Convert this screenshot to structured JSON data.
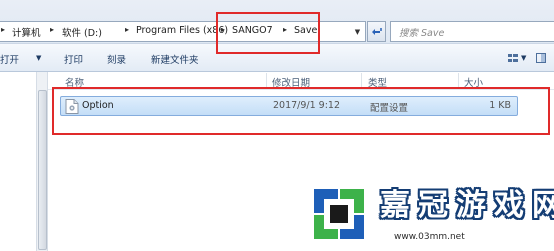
{
  "address_bar": {
    "crumbs": [
      "计算机",
      "软件 (D:)",
      "Program Files (x86)",
      "SANGO7",
      "Save"
    ],
    "separator": "▸",
    "dropdown_icon": "chevron-down-icon",
    "refresh_icon": "refresh-icon"
  },
  "search": {
    "placeholder": "搜索 Save",
    "icon": "search-icon"
  },
  "toolbar": {
    "open_label": "打开",
    "print_label": "打印",
    "burn_label": "刻录",
    "new_folder_label": "新建文件夹"
  },
  "columns": {
    "name": "名称",
    "date": "修改日期",
    "type": "类型",
    "size": "大小"
  },
  "files": [
    {
      "name": "Option",
      "modified": "2017/9/1 9:12",
      "type": "配置设置",
      "size": "1 KB"
    }
  ],
  "watermark": {
    "characters": [
      "嘉",
      "冠",
      "游",
      "戏",
      "网"
    ],
    "url": "www.03mm.net"
  },
  "colors": {
    "highlight_red": "#e02a2a",
    "selection_fill": "#cfe5fa",
    "selection_border": "#84acdd",
    "logo_blue": "#1e5fb8",
    "logo_green": "#3db24a"
  }
}
